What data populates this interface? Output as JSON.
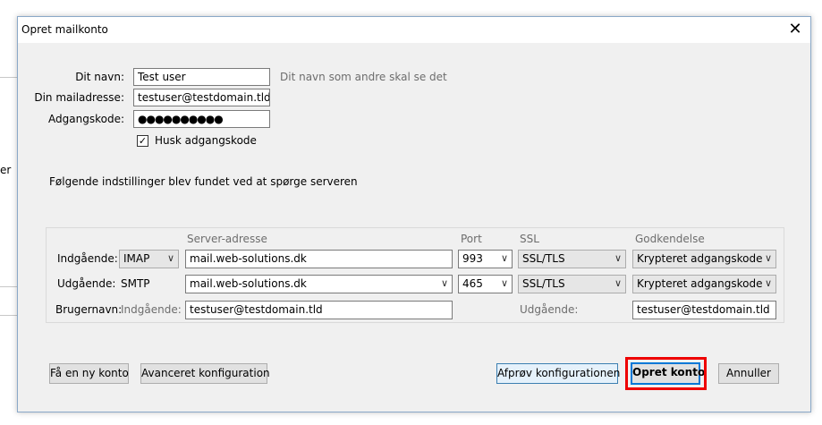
{
  "background": {
    "partial_text": "er"
  },
  "dialog": {
    "title": "Opret mailkonto",
    "close_glyph": "✕"
  },
  "form": {
    "name_label": "Dit navn:",
    "name_value": "Test user",
    "name_hint": "Dit navn som andre skal se det",
    "email_label": "Din mailadresse:",
    "email_value": "testuser@testdomain.tld",
    "password_label": "Adgangskode:",
    "password_value": "●●●●●●●●●●",
    "remember_label": "Husk adgangskode",
    "remember_checked": "✓",
    "found_message": "Følgende indstillinger blev fundet ved at spørge serveren"
  },
  "settings": {
    "headers": {
      "server": "Server-adresse",
      "port": "Port",
      "ssl": "SSL",
      "auth": "Godkendelse"
    },
    "incoming": {
      "label": "Indgående:",
      "protocol": "IMAP",
      "server": "mail.web-solutions.dk",
      "port": "993",
      "ssl": "SSL/TLS",
      "auth": "Krypteret adgangskode"
    },
    "outgoing": {
      "label": "Udgående:",
      "protocol": "SMTP",
      "server": "mail.web-solutions.dk",
      "port": "465",
      "ssl": "SSL/TLS",
      "auth": "Krypteret adgangskode"
    },
    "username": {
      "label": "Brugernavn:",
      "incoming_label": "Indgående:",
      "incoming_value": "testuser@testdomain.tld",
      "outgoing_label": "Udgående:",
      "outgoing_value": "testuser@testdomain.tld"
    }
  },
  "buttons": {
    "new_account": "Få en ny konto",
    "advanced": "Avanceret konfiguration",
    "test": "Afprøv konfigurationen",
    "create": "Opret konto",
    "cancel": "Annuller"
  },
  "icons": {
    "dropdown": "∨"
  },
  "colors": {
    "highlight": "#e00000",
    "accent": "#0078d7"
  }
}
